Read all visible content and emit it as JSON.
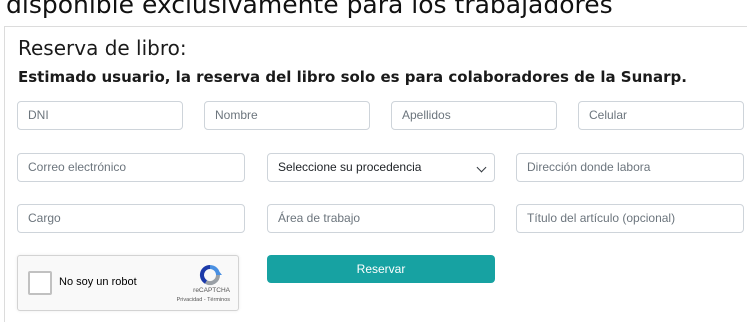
{
  "banner_text": "disponible exclusivamente para los trabajadores",
  "form": {
    "title": "Reserva de libro:",
    "subtitle": "Estimado usuario, la reserva del libro solo es para colaboradores de la Sunarp.",
    "dni_placeholder": "DNI",
    "nombre_placeholder": "Nombre",
    "apellidos_placeholder": "Apellidos",
    "celular_placeholder": "Celular",
    "correo_placeholder": "Correo electrónico",
    "procedencia_selected": "Seleccione su procedencia",
    "direccion_placeholder": "Dirección donde labora",
    "cargo_placeholder": "Cargo",
    "area_placeholder": "Área de trabajo",
    "titulo_placeholder": "Título del artículo (opcional)",
    "submit_label": "Reservar",
    "accent_color": "#17a2a2"
  },
  "captcha": {
    "label": "No soy un robot",
    "brand": "reCAPTCHA",
    "links": "Privacidad - Términos",
    "logo_icon": "recaptcha-logo"
  }
}
